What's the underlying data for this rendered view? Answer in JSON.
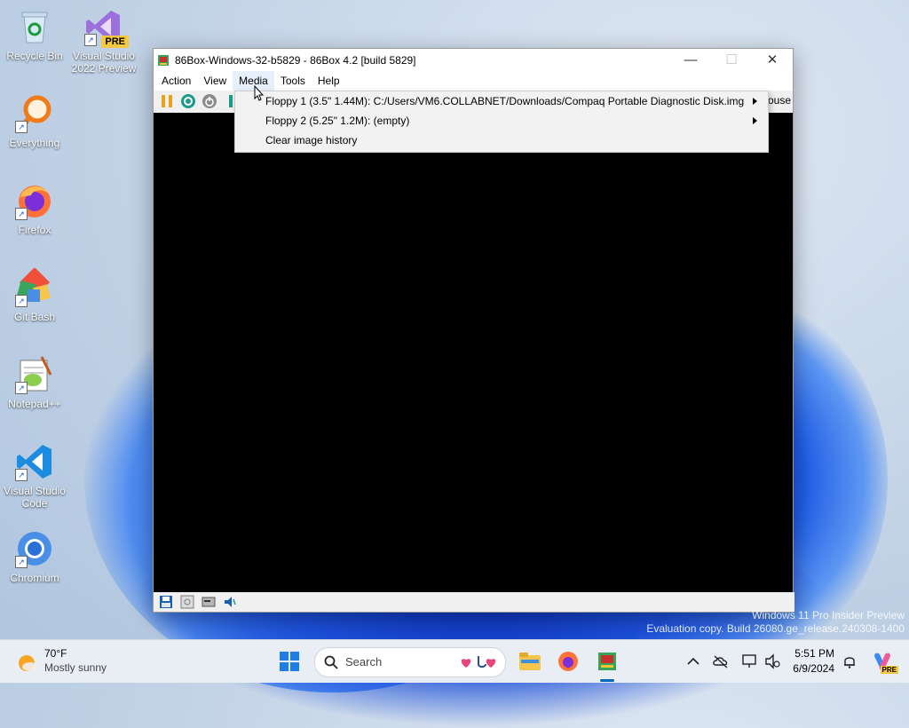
{
  "desktop": {
    "icons": [
      {
        "label": "Recycle Bin",
        "icon": "recycle-bin-icon"
      },
      {
        "label": "Visual Studio 2022 Preview",
        "badge": "PRE",
        "icon": "visual-studio-preview-icon"
      },
      {
        "label": "Everything",
        "icon": "everything-search-icon"
      },
      {
        "label": "Firefox",
        "icon": "firefox-icon"
      },
      {
        "label": "Git Bash",
        "icon": "git-bash-icon"
      },
      {
        "label": "Notepad++",
        "icon": "notepadpp-icon"
      },
      {
        "label": "Visual Studio Code",
        "icon": "vscode-icon"
      },
      {
        "label": "Chromium",
        "icon": "chromium-icon"
      }
    ],
    "watermark_line1": "Windows 11 Pro Insider Preview",
    "watermark_line2": "Evaluation copy. Build 26080.ge_release.240308-1400"
  },
  "window": {
    "title": "86Box-Windows-32-b5829 - 86Box 4.2 [build 5829]",
    "menus": [
      "Action",
      "View",
      "Media",
      "Tools",
      "Help"
    ],
    "toolbar_clipped_text": "ouse",
    "controls": {
      "minimize": "—",
      "maximize": "☐",
      "close": "✕"
    }
  },
  "media_menu": {
    "items": [
      {
        "label": "Floppy 1 (3.5\" 1.44M): C:/Users/VM6.COLLABNET/Downloads/Compaq Portable Diagnostic Disk.img",
        "submenu": true
      },
      {
        "label": "Floppy 2 (5.25\" 1.2M): (empty)",
        "submenu": true
      },
      {
        "label": "Clear image history",
        "submenu": false
      }
    ]
  },
  "taskbar": {
    "weather_temp": "70°F",
    "weather_desc": "Mostly sunny",
    "search_placeholder": "Search",
    "time": "5:51 PM",
    "date": "6/9/2024",
    "copilot_badge": "PRE"
  },
  "colors": {
    "accent": "#0067c0",
    "screen": "#000000",
    "taskbar": "#e9eef5"
  }
}
